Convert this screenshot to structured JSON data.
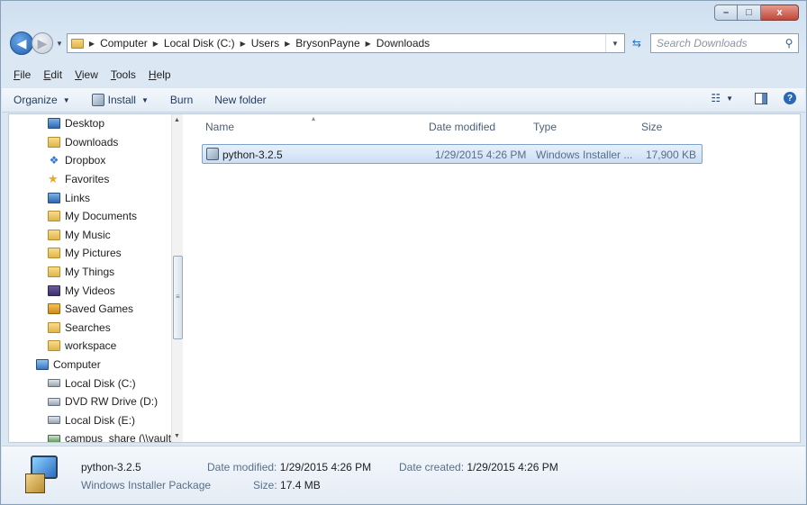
{
  "window": {
    "caption_buttons": {
      "minimize": "–",
      "maximize": "□",
      "close": "x"
    }
  },
  "address": {
    "breadcrumbs": [
      "Computer",
      "Local Disk (C:)",
      "Users",
      "BrysonPayne",
      "Downloads"
    ]
  },
  "search": {
    "placeholder": "Search Downloads"
  },
  "menu": [
    {
      "label": "File",
      "key": "F",
      "rest": "ile"
    },
    {
      "label": "Edit",
      "key": "E",
      "rest": "dit"
    },
    {
      "label": "View",
      "key": "V",
      "rest": "iew"
    },
    {
      "label": "Tools",
      "key": "T",
      "rest": "ools"
    },
    {
      "label": "Help",
      "key": "H",
      "rest": "elp"
    }
  ],
  "toolbar": {
    "organize": "Organize",
    "install": "Install",
    "burn": "Burn",
    "new_folder": "New folder"
  },
  "nav_pane": {
    "items": [
      {
        "label": "Desktop",
        "icon": "desktop-icon"
      },
      {
        "label": "Downloads",
        "icon": "downloads-icon"
      },
      {
        "label": "Dropbox",
        "icon": "dropbox-icon"
      },
      {
        "label": "Favorites",
        "icon": "favorites-icon"
      },
      {
        "label": "Links",
        "icon": "links-icon"
      },
      {
        "label": "My Documents",
        "icon": "folder-icon"
      },
      {
        "label": "My Music",
        "icon": "music-folder-icon"
      },
      {
        "label": "My Pictures",
        "icon": "pictures-folder-icon"
      },
      {
        "label": "My Things",
        "icon": "folder-icon"
      },
      {
        "label": "My Videos",
        "icon": "videos-folder-icon"
      },
      {
        "label": "Saved Games",
        "icon": "saved-games-icon"
      },
      {
        "label": "Searches",
        "icon": "searches-icon"
      },
      {
        "label": "workspace",
        "icon": "folder-icon"
      }
    ],
    "computer_label": "Computer",
    "drives": [
      {
        "label": "Local Disk (C:)",
        "icon": "hard-drive-icon"
      },
      {
        "label": "DVD RW Drive (D:)",
        "icon": "dvd-drive-icon"
      },
      {
        "label": "Local Disk (E:)",
        "icon": "hard-drive-icon"
      },
      {
        "label": "campus_share (\\\\vault_",
        "icon": "network-drive-icon"
      }
    ]
  },
  "columns": {
    "name": "Name",
    "date": "Date modified",
    "type": "Type",
    "size": "Size"
  },
  "files": [
    {
      "name": "python-3.2.5",
      "date": "1/29/2015 4:26 PM",
      "type": "Windows Installer ...",
      "size": "17,900 KB"
    }
  ],
  "details": {
    "name": "python-3.2.5",
    "type": "Windows Installer Package",
    "modified_label": "Date modified:",
    "modified_value": "1/29/2015 4:26 PM",
    "size_label": "Size:",
    "size_value": "17.4 MB",
    "created_label": "Date created:",
    "created_value": "1/29/2015 4:26 PM"
  }
}
